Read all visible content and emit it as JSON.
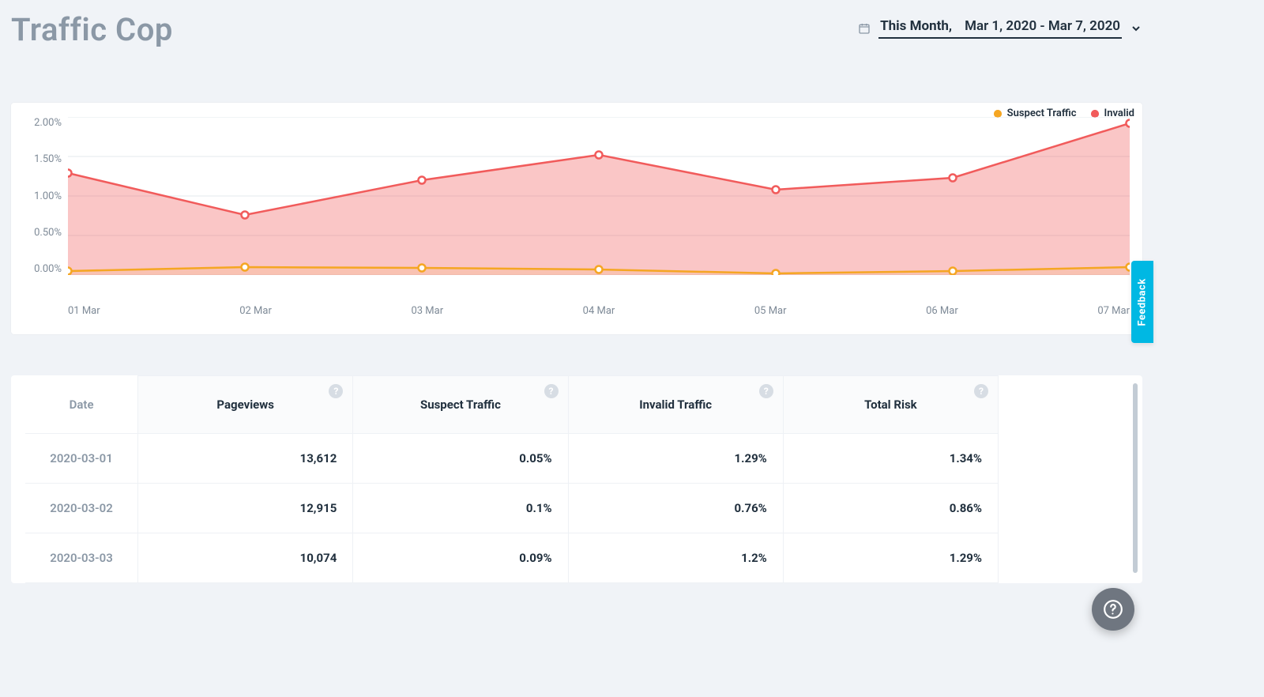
{
  "header": {
    "title": "Traffic Cop",
    "period_label": "This Month,",
    "date_range": "Mar 1, 2020 - Mar 7, 2020"
  },
  "chart_data": {
    "type": "area",
    "title": "",
    "xlabel": "",
    "ylabel": "",
    "ylim": [
      0,
      2.0
    ],
    "y_ticks": [
      "0.00%",
      "0.50%",
      "1.00%",
      "1.50%",
      "2.00%"
    ],
    "categories": [
      "01 Mar",
      "02 Mar",
      "03 Mar",
      "04 Mar",
      "05 Mar",
      "06 Mar",
      "07 Mar"
    ],
    "series": [
      {
        "name": "Suspect Traffic",
        "color": "#f5a623",
        "values": [
          0.05,
          0.1,
          0.09,
          0.07,
          0.02,
          0.05,
          0.1
        ]
      },
      {
        "name": "Invalid Traffic",
        "color": "#f15b5b",
        "values": [
          1.29,
          0.76,
          1.2,
          1.52,
          1.08,
          1.23,
          1.92
        ]
      }
    ],
    "legend": [
      "Suspect Traffic",
      "Invalid"
    ]
  },
  "table": {
    "columns": [
      "Date",
      "Pageviews",
      "Suspect Traffic",
      "Invalid Traffic",
      "Total Risk"
    ],
    "rows": [
      {
        "date": "2020-03-01",
        "pageviews": "13,612",
        "suspect": "0.05%",
        "invalid": "1.29%",
        "total": "1.34%"
      },
      {
        "date": "2020-03-02",
        "pageviews": "12,915",
        "suspect": "0.1%",
        "invalid": "0.76%",
        "total": "0.86%"
      },
      {
        "date": "2020-03-03",
        "pageviews": "10,074",
        "suspect": "0.09%",
        "invalid": "1.2%",
        "total": "1.29%"
      }
    ]
  },
  "ui": {
    "feedback_label": "Feedback"
  }
}
